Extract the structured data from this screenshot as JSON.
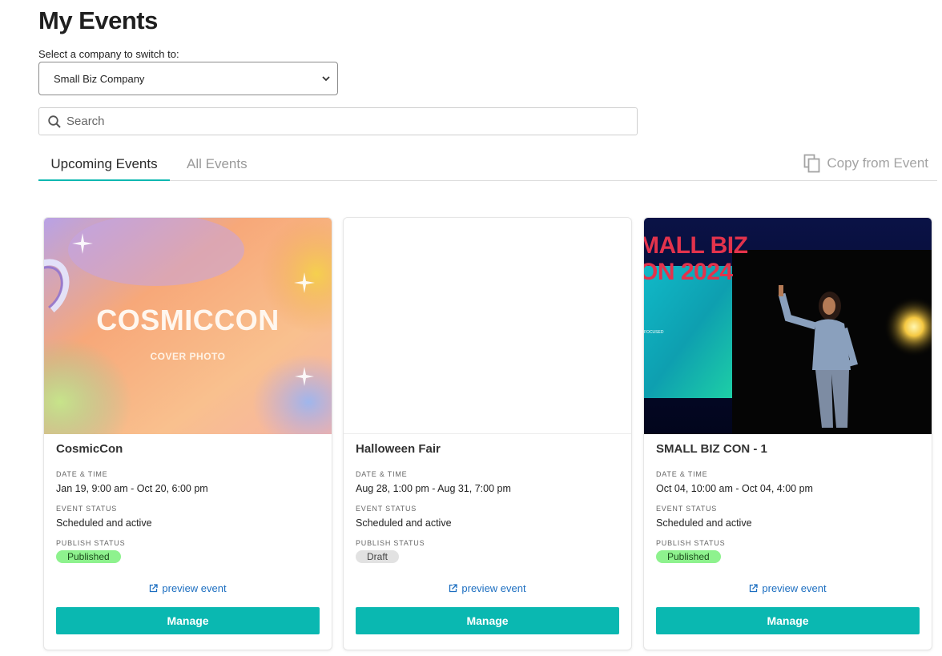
{
  "page": {
    "title": "My Events"
  },
  "company": {
    "label": "Select a company to switch to:",
    "selected": "Small Biz Company"
  },
  "search": {
    "placeholder": "Search"
  },
  "tabs": [
    {
      "label": "Upcoming Events"
    },
    {
      "label": "All Events"
    }
  ],
  "copy_action": {
    "label": "Copy from Event"
  },
  "labels": {
    "date_time": "DATE & TIME",
    "event_status": "EVENT STATUS",
    "publish_status": "PUBLISH STATUS",
    "preview": "preview event",
    "manage": "Manage"
  },
  "events": [
    {
      "name": "CosmicCon",
      "date_time": "Jan 19, 9:00 am - Oct 20, 6:00 pm",
      "event_status": "Scheduled and active",
      "publish_status": "Published",
      "cover_title": "COSMICCON",
      "cover_subtitle": "COVER PHOTO"
    },
    {
      "name": "Halloween Fair",
      "date_time": "Aug 28, 1:00 pm - Aug 31, 7:00 pm",
      "event_status": "Scheduled and active",
      "publish_status": "Draft"
    },
    {
      "name": "SMALL BIZ CON - 1",
      "date_time": "Oct 04, 10:00 am - Oct 04, 4:00 pm",
      "event_status": "Scheduled and active",
      "publish_status": "Published",
      "cover_title_line1": "MALL BIZ",
      "cover_title_line2": "ON 2024",
      "cover_small": "FOCUSED"
    }
  ],
  "colors": {
    "accent": "#0ab8b1",
    "published": "#8ef28e",
    "draft": "#e2e2e2",
    "link": "#1c6ec0"
  }
}
